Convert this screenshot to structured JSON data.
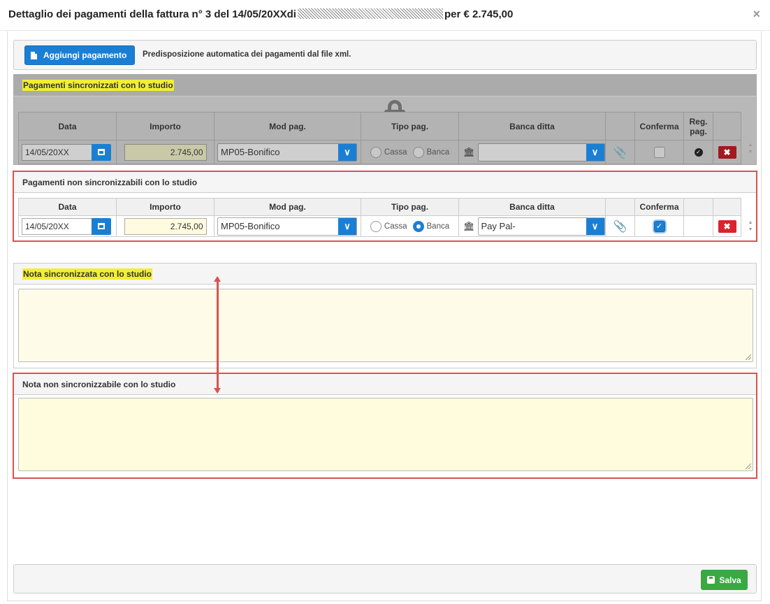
{
  "header": {
    "title_prefix": "Dettaglio dei pagamenti della fattura n° 3 del 14/05/20XXdi",
    "title_suffix": "per € 2.745,00",
    "close_icon": "×"
  },
  "toolbar": {
    "add_label": "Aggiungi pagamento",
    "info_text": "Predisposizione automatica dei pagamenti dal file xml."
  },
  "columns": [
    "Data",
    "Importo",
    "Mod pag.",
    "Tipo pag.",
    "Banca ditta",
    "",
    "Conferma",
    "Reg. pag.",
    ""
  ],
  "columns_unsynced": [
    "Data",
    "Importo",
    "Mod pag.",
    "Tipo pag.",
    "Banca ditta",
    "",
    "Conferma",
    "",
    ""
  ],
  "synced": {
    "title": "Pagamenti sincronizzati con lo studio",
    "row": {
      "date": "14/05/20XX",
      "amount": "2.745,00",
      "mod": "MP05-Bonifico",
      "radio_cassa": "Cassa",
      "radio_banca": "Banca",
      "selected": "none",
      "bank": "",
      "confirmed": false,
      "registered": true
    }
  },
  "unsynced": {
    "title": "Pagamenti non sincronizzabili con lo studio",
    "row": {
      "date": "14/05/20XX",
      "amount": "2.745,00",
      "mod": "MP05-Bonifico",
      "radio_cassa": "Cassa",
      "radio_banca": "Banca",
      "selected": "Banca",
      "bank": "Pay Pal-",
      "confirmed": true
    }
  },
  "note_synced": {
    "title": "Nota sincronizzata con lo studio",
    "value": ""
  },
  "note_unsynced": {
    "title": "Nota non sincronizzabile con lo studio",
    "value": ""
  },
  "footer": {
    "save_label": "Salva"
  },
  "colors": {
    "primary": "#1a7fd4",
    "danger": "#d9232e",
    "success": "#3aa843",
    "highlight": "#f2ef33",
    "annotation": "#d9534f"
  }
}
